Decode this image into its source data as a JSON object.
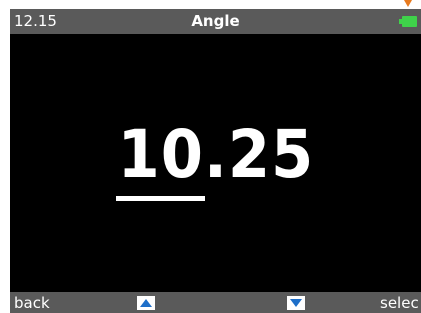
{
  "status_bar": {
    "time": "12.15",
    "title": "Angle",
    "battery_icon": "battery-full-icon",
    "battery_color": "#3fd24a"
  },
  "main": {
    "value": "10.25"
  },
  "softkeys": {
    "left_label": "back",
    "up_icon": "arrow-up-icon",
    "down_icon": "arrow-down-icon",
    "right_label": "selec"
  },
  "colors": {
    "screen_bg": "#000000",
    "bar_bg": "#5a5a5a",
    "arrow_color": "#1e6fc9",
    "indicator_color": "#e87a1e"
  }
}
